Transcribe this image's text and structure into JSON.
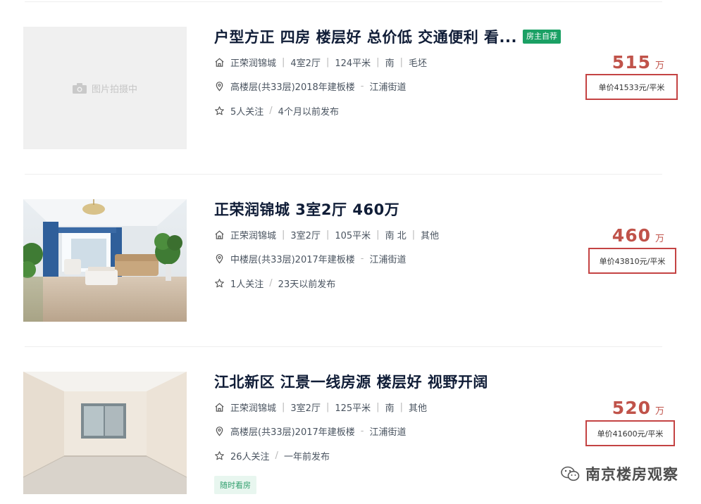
{
  "listings": [
    {
      "title": "户型方正 四房 楼层好 总价低 交通便利 看...",
      "tag": "房主自荐",
      "image_placeholder": "图片拍摄中",
      "community": "正荣润锦城",
      "layout": "4室2厅",
      "area": "124平米",
      "orientation": "南",
      "decoration": "毛坯",
      "floor_info": "高楼层(共33层)2018年建板楼",
      "district": "江浦街道",
      "follow": "5人关注",
      "published": "4个月以前发布",
      "total_price": "515",
      "total_unit": "万",
      "unit_price": "单价41533元/平米"
    },
    {
      "title": "正荣润锦城 3室2厅 460万",
      "community": "正荣润锦城",
      "layout": "3室2厅",
      "area": "105平米",
      "orientation": "南 北",
      "decoration": "其他",
      "floor_info": "中楼层(共33层)2017年建板楼",
      "district": "江浦街道",
      "follow": "1人关注",
      "published": "23天以前发布",
      "total_price": "460",
      "total_unit": "万",
      "unit_price": "单价43810元/平米"
    },
    {
      "title": "江北新区 江景一线房源 楼层好 视野开阔",
      "community": "正荣润锦城",
      "layout": "3室2厅",
      "area": "125平米",
      "orientation": "南",
      "decoration": "其他",
      "floor_info": "高楼层(共33层)2017年建板楼",
      "district": "江浦街道",
      "follow": "26人关注",
      "published": "一年前发布",
      "total_price": "520",
      "total_unit": "万",
      "unit_price": "单价41600元/平米",
      "extra_tag": "随时看房"
    }
  ],
  "separators": {
    "pipe": "|",
    "dash": "-",
    "slash": "/"
  },
  "watermark": {
    "text": "南京楼房观察"
  },
  "colors": {
    "price": "#c0534a",
    "highlight_box": "#c44343",
    "tag_green": "#1aa064",
    "title": "#101d37"
  },
  "icons": [
    "house-icon",
    "location-pin-icon",
    "star-icon",
    "camera-icon",
    "wechat-icon"
  ]
}
